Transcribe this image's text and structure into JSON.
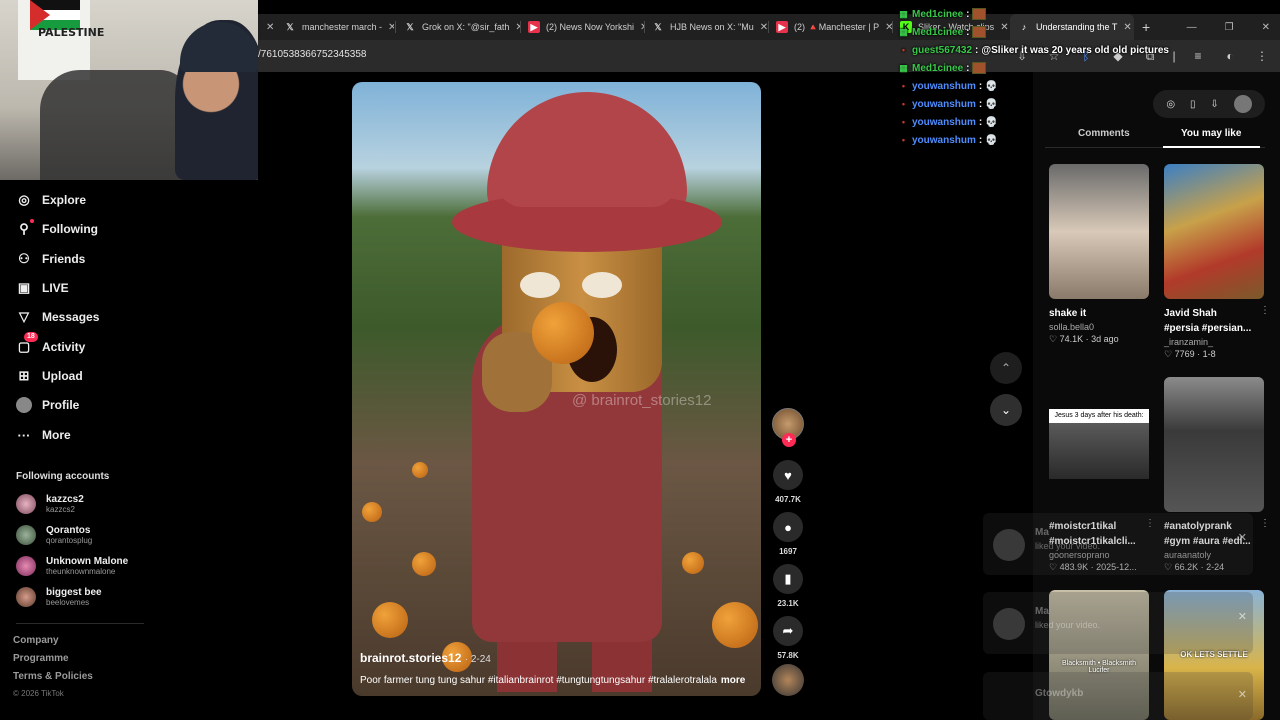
{
  "browser": {
    "tabs": [
      {
        "label": "manchester march -",
        "icon": "x-logo-icon",
        "active": false
      },
      {
        "label": "Grok on X: \"@sir_fath",
        "icon": "x-logo-icon",
        "active": false
      },
      {
        "label": "(2) News Now Yorkshi",
        "icon": "youtube-icon",
        "active": false
      },
      {
        "label": "HJB News on X: \"Mu",
        "icon": "x-logo-icon",
        "active": false
      },
      {
        "label": "(2) 🔺Manchester | P",
        "icon": "youtube-icon",
        "active": false
      },
      {
        "label": "Sliker - Watch clips",
        "icon": "kick-icon",
        "active": false
      },
      {
        "label": "Understanding the T",
        "icon": "tiktok-icon",
        "active": true
      }
    ],
    "new_tab": "+",
    "url": "/7610538366752345358"
  },
  "webcam": {
    "poster_text": "PALESTINE"
  },
  "sidebar": {
    "nav": [
      {
        "label": "Explore",
        "icon": "compass-icon"
      },
      {
        "label": "Following",
        "icon": "following-icon"
      },
      {
        "label": "Friends",
        "icon": "friends-icon"
      },
      {
        "label": "LIVE",
        "icon": "live-icon"
      },
      {
        "label": "Messages",
        "icon": "messages-icon"
      },
      {
        "label": "Activity",
        "icon": "activity-icon",
        "badge": "18"
      },
      {
        "label": "Upload",
        "icon": "upload-icon"
      },
      {
        "label": "Profile",
        "icon": "profile-avatar"
      },
      {
        "label": "More",
        "icon": "more-icon"
      }
    ],
    "following_title": "Following accounts",
    "accounts": [
      {
        "name": "kazzcs2",
        "handle": "kazzcs2"
      },
      {
        "name": "Qorantos",
        "handle": "qorantosplug"
      },
      {
        "name": "Unknown Malone",
        "handle": "theunknownmalone"
      },
      {
        "name": "biggest bee",
        "handle": "beelovemes"
      }
    ],
    "footer": [
      "Company",
      "Programme",
      "Terms & Policies"
    ],
    "copyright": "© 2026 TikTok"
  },
  "video": {
    "watermark": "@ brainrot_stories12",
    "username": "brainrot.stories12",
    "date": "2-24",
    "caption": "Poor farmer tung tung sahur #italianbrainrot #tungtungtungsahur #tralalerotralala",
    "more": "more"
  },
  "actions": {
    "likes": "407.7K",
    "comments": "1697",
    "saves": "23.1K",
    "shares": "57.8K"
  },
  "chat": [
    {
      "user": "Med1cinee",
      "text": "",
      "color": "#39c94a",
      "icon": "badge-icon",
      "emote": true
    },
    {
      "user": "Med1cinee",
      "text": "",
      "color": "#39c94a",
      "icon": "badge-icon",
      "emote": true
    },
    {
      "user": "guest567432",
      "text": "@Sliker it was 20 years old old pictures",
      "color": "#39c94a",
      "icon": "dot-icon",
      "emote": false
    },
    {
      "user": "Med1cinee",
      "text": "",
      "color": "#39c94a",
      "icon": "badge-icon",
      "emote": true
    },
    {
      "user": "youwanshum",
      "text": "💀",
      "color": "#4f8dff",
      "icon": "dot-icon",
      "emote": false
    },
    {
      "user": "youwanshum",
      "text": "💀",
      "color": "#4f8dff",
      "icon": "dot-icon",
      "emote": false
    },
    {
      "user": "youwanshum",
      "text": "💀",
      "color": "#4f8dff",
      "icon": "dot-icon",
      "emote": false
    },
    {
      "user": "youwanshum",
      "text": "💀",
      "color": "#4f8dff",
      "icon": "dot-icon",
      "emote": false
    }
  ],
  "right_panel": {
    "tabs": [
      "Comments",
      "You may like"
    ],
    "active_tab": "You may like",
    "cards": [
      {
        "title": "shake it",
        "title2": "",
        "author": "solla.bella0",
        "meta": "♡ 74.1K · 3d ago"
      },
      {
        "title": "Javid Shah",
        "title2": "#persia #persian...",
        "author": "_iranzamin_",
        "meta": "♡ 7769 · 1-8"
      },
      {
        "title": "#moistcr1tikal",
        "title2": "#moistcr1tikalcli...",
        "author": "goonersoprano",
        "meta": "♡ 483.9K · 2025-12...",
        "overlay": "Jesus 3 days after his death:"
      },
      {
        "title": "#anatolyprank",
        "title2": "#gym #aura #edi...",
        "author": "auraanatoly",
        "meta": "♡ 66.2K · 2-24"
      },
      {
        "title": "",
        "title2": "",
        "author": "",
        "meta": "",
        "overlay": "Blacksmith • Blacksmith Lucifer"
      },
      {
        "title": "",
        "title2": "",
        "author": "",
        "meta": "",
        "overlay": "OK LETS SETTLE"
      }
    ],
    "notifications": [
      {
        "name": "Ma",
        "text": "liked your video."
      },
      {
        "name": "Ma",
        "text": "liked your video."
      },
      {
        "name": "Gtowdykb",
        "text": ""
      }
    ]
  },
  "colors": {
    "accent": "#fe2c55",
    "chat_green": "#39c94a",
    "chat_blue": "#4f8dff"
  }
}
